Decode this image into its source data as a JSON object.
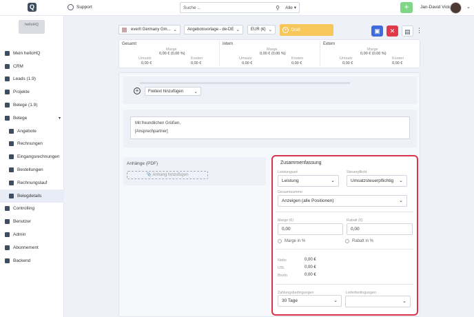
{
  "topbar": {
    "logo_letter": "Q",
    "support_label": "Support",
    "search_placeholder": "Suche ...",
    "search_scope": "Alle",
    "add_label": "+",
    "user_name": "Jan-David Vick"
  },
  "sidebar": {
    "brand": "helloHQ",
    "items": [
      {
        "label": "Mein helloHQ",
        "sub": false
      },
      {
        "label": "CRM",
        "sub": false
      },
      {
        "label": "Leads (1.9)",
        "sub": false
      },
      {
        "label": "Projekte",
        "sub": false
      },
      {
        "label": "Belege (1.9)",
        "sub": false
      },
      {
        "label": "Belege",
        "sub": false,
        "expanded": true
      },
      {
        "label": "Angebote",
        "sub": true
      },
      {
        "label": "Rechnungen",
        "sub": true
      },
      {
        "label": "Eingangsrechnungen",
        "sub": true
      },
      {
        "label": "Bestellungen",
        "sub": true
      },
      {
        "label": "Rechnungslauf",
        "sub": true
      },
      {
        "label": "Belegdetails",
        "sub": true,
        "active": true
      },
      {
        "label": "Controlling",
        "sub": false
      },
      {
        "label": "Benutzer",
        "sub": false
      },
      {
        "label": "Admin",
        "sub": false
      },
      {
        "label": "Abonnement",
        "sub": false
      },
      {
        "label": "Backend",
        "sub": false
      }
    ]
  },
  "toolbar": {
    "company": "everII Germany Gm...",
    "template": "Angebotsvorlage - de-DE",
    "currency": "EUR (€)",
    "status": "Draft"
  },
  "kpis": [
    {
      "title": "Gesamt",
      "marge_label": "Marge",
      "marge_value": "0,00 € (0,00 %)",
      "umsatz_label": "Umsatz",
      "umsatz_value": "0,00 €",
      "kosten_label": "Kosten",
      "kosten_value": "0,00 €"
    },
    {
      "title": "Intern",
      "marge_label": "Marge",
      "marge_value": "0,00 € (0,00 %)",
      "umsatz_label": "Umsatz",
      "umsatz_value": "0,00 €",
      "kosten_label": "Kosten",
      "kosten_value": "0,00 €"
    },
    {
      "title": "Extern",
      "marge_label": "Marge",
      "marge_value": "0,00 € (0,00 %)",
      "umsatz_label": "Umsatz",
      "umsatz_value": "0,00 €",
      "kosten_label": "Kosten",
      "kosten_value": "0,00 €"
    }
  ],
  "editor": {
    "freetext_label": "Freitext hinzufügen",
    "closing_line1": "Mit freundlichen Grüßen,",
    "closing_line2": "[Ansprechpartner]"
  },
  "attachments": {
    "title": "Anhänge (PDF)",
    "add_label": "Anhang hinzufügen"
  },
  "summary": {
    "title": "Zusammenfassung",
    "leistungsart_label": "Leistungsart",
    "leistungsart_value": "Leistung",
    "steuerpflicht_label": "Steuerpflicht",
    "steuerpflicht_value": "Umsatzsteuerpflichtig",
    "gesamtsumme_label": "Gesamtsumme",
    "gesamtsumme_value": "Anzeigen (alle Positionen)",
    "marge_label": "Marge (€)",
    "marge_value": "0,00",
    "rabatt_label": "Rabatt (€)",
    "rabatt_value": "0,00",
    "marge_pct_label": "Marge in %",
    "rabatt_pct_label": "Rabatt in %",
    "netto_label": "Netto",
    "netto_value": "0,00 €",
    "ust_label": "USt.",
    "ust_value": "0,00 €",
    "brutto_label": "Brutto",
    "brutto_value": "0,00 €",
    "zahlung_label": "Zahlungsbedingungen",
    "zahlung_value": "30 Tage",
    "liefer_label": "Lieferbedingungen",
    "liefer_value": ""
  },
  "colors": {
    "accent": "#3d4e63",
    "save": "#3d6be0",
    "cancel": "#e0394a",
    "draft": "#f7c75c",
    "highlight": "#d9334b",
    "add": "#7ed686"
  }
}
